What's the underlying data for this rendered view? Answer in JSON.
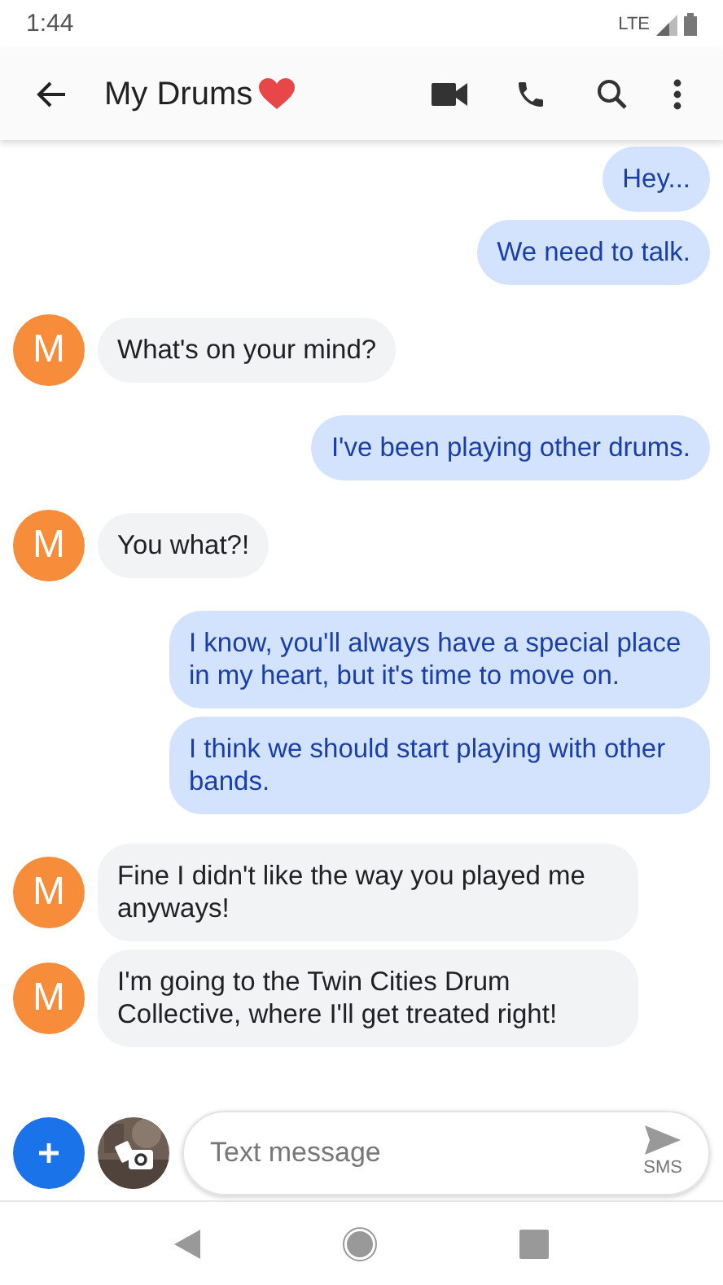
{
  "status_bar": {
    "time": "1:44",
    "network": "LTE"
  },
  "header": {
    "title": "My Drums"
  },
  "messages": [
    {
      "kind": "sent",
      "text": "Hey..."
    },
    {
      "kind": "sent",
      "text": "We need to talk."
    },
    {
      "kind": "received",
      "avatar": "M",
      "text": "What's on your mind?"
    },
    {
      "kind": "sent",
      "text": "I've been playing other drums."
    },
    {
      "kind": "received",
      "avatar": "M",
      "text": "You what?!"
    },
    {
      "kind": "sent",
      "text": "I know, you'll always have a special place in my heart, but it's time to move on."
    },
    {
      "kind": "sent",
      "text": "I think we should start playing with other bands."
    },
    {
      "kind": "received",
      "avatar": "M",
      "text": "Fine I didn't like the way you played me anyways!"
    },
    {
      "kind": "received",
      "avatar": "M",
      "text": "I'm going to the Twin Cities Drum Collective, where I'll get treated right!"
    }
  ],
  "composer": {
    "placeholder": "Text message",
    "send_label": "SMS"
  }
}
